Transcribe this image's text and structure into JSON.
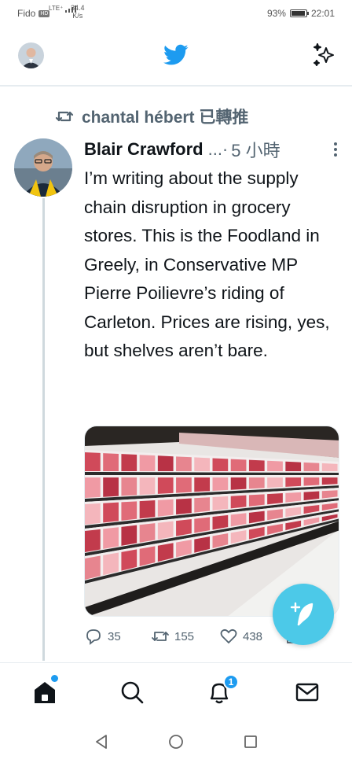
{
  "status_bar": {
    "carrier": "Fido",
    "hd": "HD",
    "network": "LTE⁺",
    "speed_value": "34.4",
    "speed_unit": "K/s",
    "battery": "93%",
    "battery_level": 0.93,
    "time": "22:01"
  },
  "header": {
    "logo_icon": "twitter-bird-icon",
    "avatar": "profile-avatar",
    "sparkle_icon": "sparkle-icon"
  },
  "tweet": {
    "retweeted_by": "chantal hébert 已轉推",
    "author_name": "Blair Crawford",
    "author_handle": "...·",
    "time": "5 小時",
    "text": "I’m writing about the supply chain disruption in grocery stores. This is the Foodland in Greely, in Conservative MP Pierre Poilievre’s riding of Carleton. Prices are rising, yes, but shelves aren’t bare.",
    "media_alt": "grocery-meat-shelves-photo",
    "actions": {
      "replies": "35",
      "retweets": "155",
      "likes": "438"
    }
  },
  "bottom_nav": {
    "items": [
      "home",
      "search",
      "notifications",
      "messages"
    ],
    "notification_count": "1"
  },
  "colors": {
    "brand": "#1d9bf0",
    "fab": "#4cc9e8",
    "muted": "#536471"
  }
}
